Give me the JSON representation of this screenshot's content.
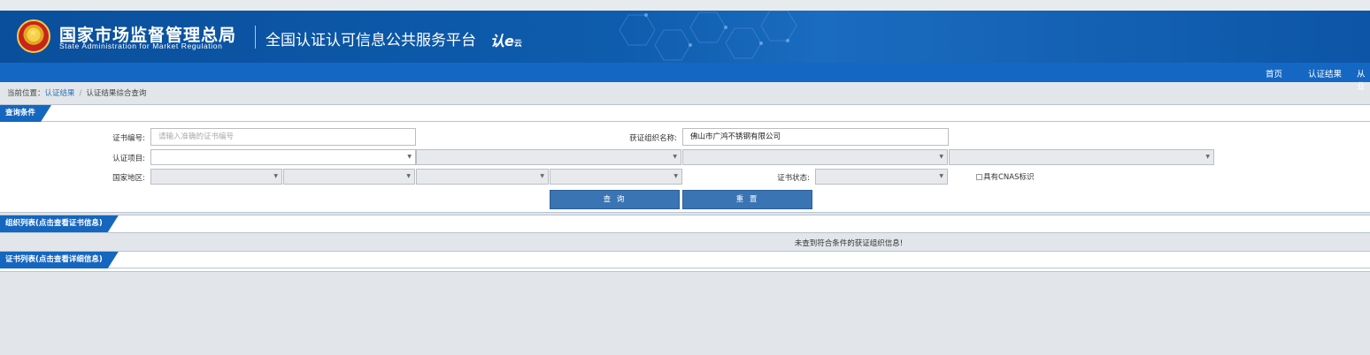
{
  "header": {
    "org_cn": "国家市场监督管理总局",
    "org_en": "State Administration  for  Market Regulation",
    "platform": "全国认证认可信息公共服务平台",
    "cloud_main": "认e",
    "cloud_sub": "云"
  },
  "nav": {
    "items": [
      "首页",
      "认证结果",
      "从业"
    ]
  },
  "breadcrumb": {
    "prefix": "当前位置：",
    "link": "认证结果",
    "separator": "/",
    "current": "认证结果综合查询"
  },
  "query": {
    "tab": "查询条件",
    "cert_no_label": "证书编号:",
    "cert_no_placeholder": "请输入准确的证书编号",
    "org_name_label": "获证组织名称:",
    "org_name_value": "佛山市广鸿不锈钢有限公司",
    "project_label": "认证项目:",
    "region_label": "国家地区:",
    "status_label": "证书状态:",
    "cnas_label": "具有CNAS标识",
    "search_btn": "查 询",
    "reset_btn": "重 置"
  },
  "org_list": {
    "tab": "组织列表(点击查看证书信息)",
    "empty_msg": "未查到符合条件的获证组织信息!"
  },
  "cert_list": {
    "tab": "证书列表(点击查看详细信息)"
  },
  "colors": {
    "banner": "#0e5cad",
    "nav": "#1468c3",
    "tab": "#1566bf",
    "button": "#3a74b3",
    "page_bg": "#e2e6ea"
  },
  "icons": {
    "emblem": "national-emblem-icon",
    "select_arrow": "caret-down-icon",
    "checkbox": "checkbox-icon"
  }
}
